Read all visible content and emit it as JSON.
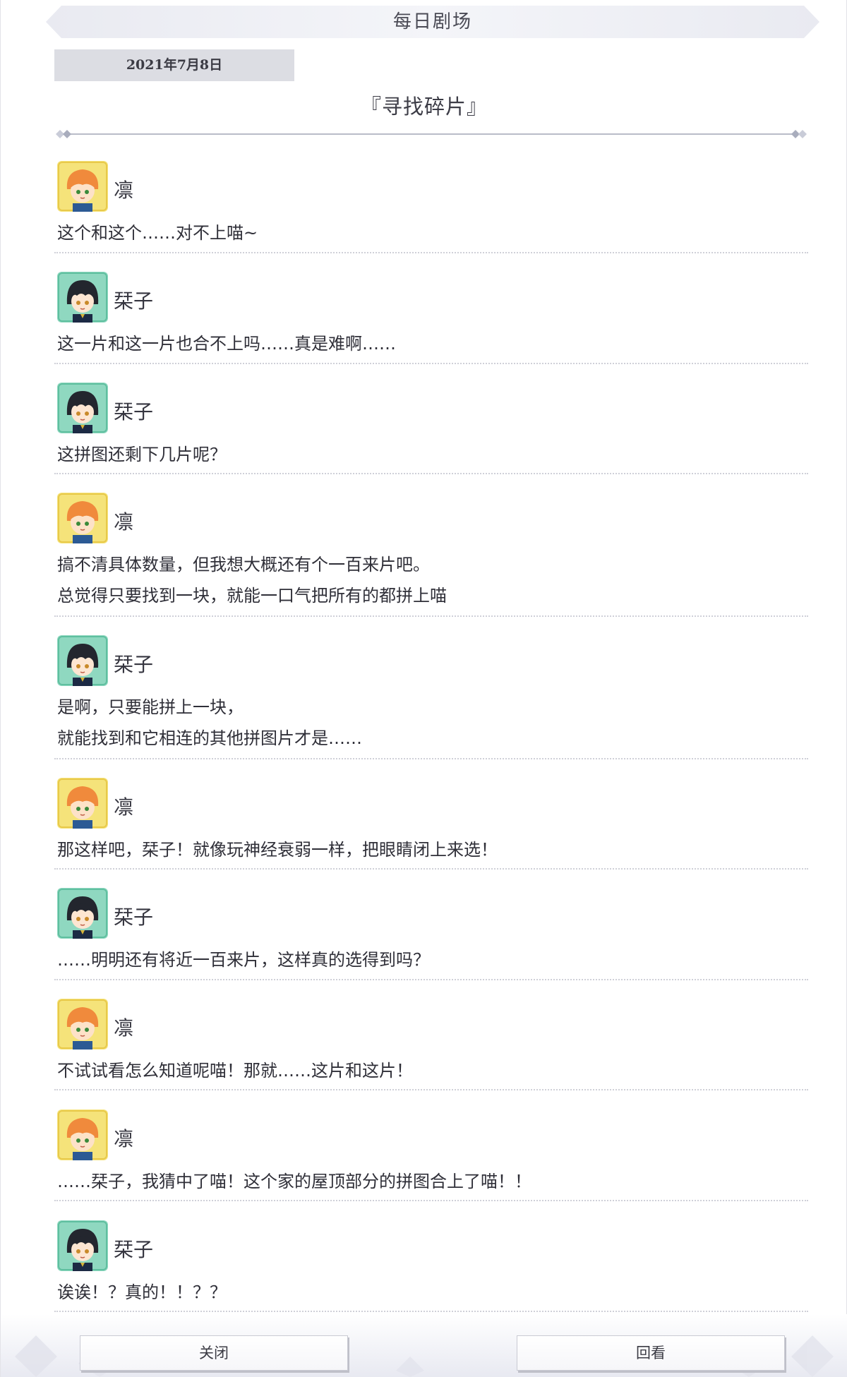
{
  "header": {
    "title": "每日剧场"
  },
  "date": "2021年7月8日",
  "episode_title": "『寻找碎片』",
  "dialogue": [
    {
      "speaker": "凛",
      "avatar": "rin-avatar-icon",
      "lines": [
        "这个和这个……对不上喵~"
      ]
    },
    {
      "speaker": "栞子",
      "avatar": "shioriko-avatar-icon",
      "lines": [
        "这一片和这一片也合不上吗……真是难啊……"
      ]
    },
    {
      "speaker": "栞子",
      "avatar": "shioriko-avatar-icon",
      "lines": [
        "这拼图还剩下几片呢？"
      ]
    },
    {
      "speaker": "凛",
      "avatar": "rin-avatar-icon",
      "lines": [
        "搞不清具体数量，但我想大概还有个一百来片吧。",
        "总觉得只要找到一块，就能一口气把所有的都拼上喵"
      ]
    },
    {
      "speaker": "栞子",
      "avatar": "shioriko-avatar-icon",
      "lines": [
        "是啊，只要能拼上一块，",
        "就能找到和它相连的其他拼图片才是……"
      ]
    },
    {
      "speaker": "凛",
      "avatar": "rin-avatar-icon",
      "lines": [
        "那这样吧，栞子！就像玩神经衰弱一样，把眼睛闭上来选！"
      ]
    },
    {
      "speaker": "栞子",
      "avatar": "shioriko-avatar-icon",
      "lines": [
        "……明明还有将近一百来片，这样真的选得到吗？"
      ]
    },
    {
      "speaker": "凛",
      "avatar": "rin-avatar-icon",
      "lines": [
        "不试试看怎么知道呢喵！那就……这片和这片！"
      ]
    },
    {
      "speaker": "凛",
      "avatar": "rin-avatar-icon",
      "lines": [
        "……栞子，我猜中了喵！这个家的屋顶部分的拼图合上了喵！！"
      ]
    },
    {
      "speaker": "栞子",
      "avatar": "shioriko-avatar-icon",
      "lines": [
        "诶诶！？真的！！？？"
      ]
    }
  ],
  "footer": {
    "close_label": "关闭",
    "review_label": "回看"
  },
  "colors": {
    "rin_avatar_bg": "#f5e37a",
    "shioriko_avatar_bg": "#8fd8c0",
    "date_chip_bg": "#dcdde3"
  }
}
